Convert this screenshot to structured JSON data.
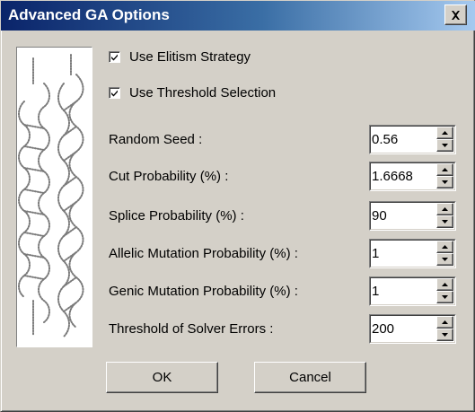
{
  "window": {
    "title": "Advanced GA Options",
    "close_icon": "close-x-icon"
  },
  "options": {
    "use_elitism": {
      "label": "Use Elitism Strategy",
      "checked": true
    },
    "use_threshold": {
      "label": "Use Threshold Selection",
      "checked": true
    }
  },
  "fields": {
    "random_seed": {
      "label": "Random Seed :",
      "value": "0.56"
    },
    "cut_probability": {
      "label": "Cut Probability (%) :",
      "value": "1.6668"
    },
    "splice_probability": {
      "label": "Splice Probability (%) :",
      "value": "90"
    },
    "allelic_mutation": {
      "label": "Allelic Mutation Probability (%) :",
      "value": "1"
    },
    "genic_mutation": {
      "label": "Genic Mutation Probability (%) :",
      "value": "1"
    },
    "solver_threshold": {
      "label": "Threshold of Solver Errors :",
      "value": "200"
    }
  },
  "buttons": {
    "ok": "OK",
    "cancel": "Cancel"
  },
  "icons": {
    "spin_up": "spin-up-arrow-icon",
    "spin_down": "spin-down-arrow-icon",
    "check": "check-mark-icon",
    "graphic": "dna-strands-illustration"
  },
  "colors": {
    "face": "#d4d0c8",
    "title_start": "#0a246a",
    "title_end": "#a6caf0"
  }
}
